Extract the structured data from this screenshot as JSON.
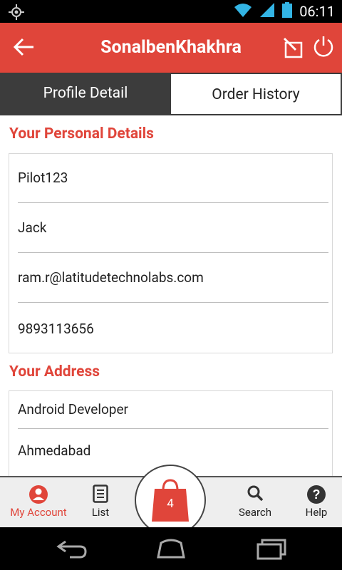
{
  "status": {
    "time": "06:11"
  },
  "header": {
    "title": "SonalbenKhakhra"
  },
  "tabs": [
    {
      "label": "Profile Detail"
    },
    {
      "label": "Order History"
    }
  ],
  "personal": {
    "title": "Your Personal Details",
    "fields": [
      "Pilot123",
      "Jack",
      "ram.r@latitudetechnolabs.com",
      "9893113656"
    ]
  },
  "address": {
    "title": "Your Address",
    "fields": [
      "Android Developer",
      "Ahmedabad"
    ]
  },
  "bottom_nav": {
    "account": "My Account",
    "list": "List",
    "cart_count": "4",
    "search": "Search",
    "help": "Help"
  },
  "colors": {
    "accent": "#e0453a",
    "tab_active": "#3c3c3c"
  }
}
